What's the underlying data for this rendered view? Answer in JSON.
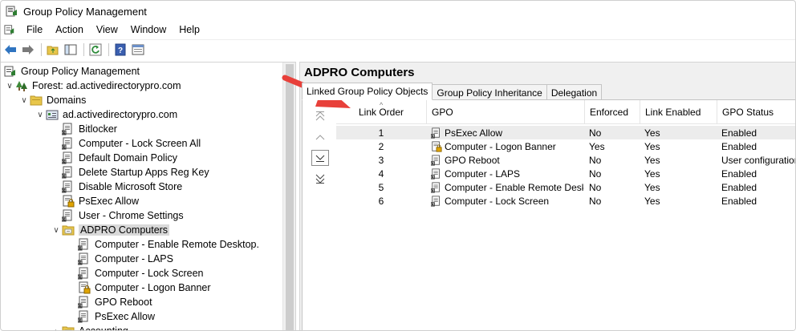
{
  "window": {
    "title": "Group Policy Management"
  },
  "menu": [
    "File",
    "Action",
    "View",
    "Window",
    "Help"
  ],
  "tree": [
    {
      "label": "Group Policy Management",
      "indent": 0,
      "exp": "",
      "icon": "gpm-console-icon",
      "name": "tree-root"
    },
    {
      "label": "Forest: ad.activedirectorypro.com",
      "indent": 1,
      "exp": "v",
      "icon": "forest-icon",
      "name": "tree-forest"
    },
    {
      "label": "Domains",
      "indent": 2,
      "exp": "v",
      "icon": "folder-icon",
      "name": "tree-domains"
    },
    {
      "label": "ad.activedirectorypro.com",
      "indent": 3,
      "exp": "v",
      "icon": "domain-icon",
      "name": "tree-domain"
    },
    {
      "label": "Bitlocker",
      "indent": 4,
      "exp": "",
      "icon": "gpo-link-icon",
      "name": "tree-gpo-bitlocker"
    },
    {
      "label": "Computer - Lock Screen All",
      "indent": 4,
      "exp": "",
      "icon": "gpo-link-icon",
      "name": "tree-gpo-lock-screen-all"
    },
    {
      "label": "Default Domain Policy",
      "indent": 4,
      "exp": "",
      "icon": "gpo-link-icon",
      "name": "tree-gpo-default-domain"
    },
    {
      "label": "Delete Startup Apps Reg Key",
      "indent": 4,
      "exp": "",
      "icon": "gpo-link-icon",
      "name": "tree-gpo-delete-startup"
    },
    {
      "label": "Disable Microsoft Store",
      "indent": 4,
      "exp": "",
      "icon": "gpo-link-icon",
      "name": "tree-gpo-disable-store"
    },
    {
      "label": "PsExec Allow",
      "indent": 4,
      "exp": "",
      "icon": "gpo-lock-icon",
      "name": "tree-gpo-psexec"
    },
    {
      "label": "User - Chrome Settings",
      "indent": 4,
      "exp": "",
      "icon": "gpo-link-icon",
      "name": "tree-gpo-chrome"
    },
    {
      "label": "ADPRO Computers",
      "indent": 4,
      "exp": "v",
      "icon": "ou-folder-icon",
      "name": "tree-ou-adpro-computers",
      "selected": true
    },
    {
      "label": "Computer - Enable Remote Desktop.",
      "indent": 5,
      "exp": "",
      "icon": "gpo-link-icon",
      "name": "tree-gpo-remote-desktop"
    },
    {
      "label": "Computer - LAPS",
      "indent": 5,
      "exp": "",
      "icon": "gpo-link-icon",
      "name": "tree-gpo-laps"
    },
    {
      "label": "Computer - Lock Screen",
      "indent": 5,
      "exp": "",
      "icon": "gpo-link-icon",
      "name": "tree-gpo-lock-screen"
    },
    {
      "label": "Computer - Logon Banner",
      "indent": 5,
      "exp": "",
      "icon": "gpo-lock-icon",
      "name": "tree-gpo-logon-banner"
    },
    {
      "label": "GPO Reboot",
      "indent": 5,
      "exp": "",
      "icon": "gpo-link-icon",
      "name": "tree-gpo-reboot"
    },
    {
      "label": "PsExec Allow",
      "indent": 5,
      "exp": "",
      "icon": "gpo-link-icon",
      "name": "tree-gpo-psexec-2"
    },
    {
      "label": "Accounting",
      "indent": 4,
      "exp": ">",
      "icon": "ou-folder-icon",
      "name": "tree-ou-accounting"
    }
  ],
  "right": {
    "title": "ADPRO Computers",
    "tabs": [
      "Linked Group Policy Objects",
      "Group Policy Inheritance",
      "Delegation"
    ],
    "columns": [
      "Link Order",
      "GPO",
      "Enforced",
      "Link Enabled",
      "GPO Status"
    ],
    "rows": [
      {
        "order": "1",
        "gpo": "PsExec Allow",
        "enforced": "No",
        "link_enabled": "Yes",
        "status": "Enabled",
        "icon": "gpo-link-icon"
      },
      {
        "order": "2",
        "gpo": "Computer - Logon Banner",
        "enforced": "Yes",
        "link_enabled": "Yes",
        "status": "Enabled",
        "icon": "gpo-lock-icon"
      },
      {
        "order": "3",
        "gpo": "GPO Reboot",
        "enforced": "No",
        "link_enabled": "Yes",
        "status": "User configuration ...",
        "icon": "gpo-link-icon"
      },
      {
        "order": "4",
        "gpo": "Computer - LAPS",
        "enforced": "No",
        "link_enabled": "Yes",
        "status": "Enabled",
        "icon": "gpo-link-icon"
      },
      {
        "order": "5",
        "gpo": "Computer - Enable Remote Deskt...",
        "enforced": "No",
        "link_enabled": "Yes",
        "status": "Enabled",
        "icon": "gpo-link-icon"
      },
      {
        "order": "6",
        "gpo": "Computer - Lock Screen",
        "enforced": "No",
        "link_enabled": "Yes",
        "status": "Enabled",
        "icon": "gpo-link-icon"
      }
    ]
  },
  "colors": {
    "annotation_arrow": "#e8403a",
    "selected_bg": "#d9d9d9",
    "pane_bg": "#f0f0f0"
  }
}
